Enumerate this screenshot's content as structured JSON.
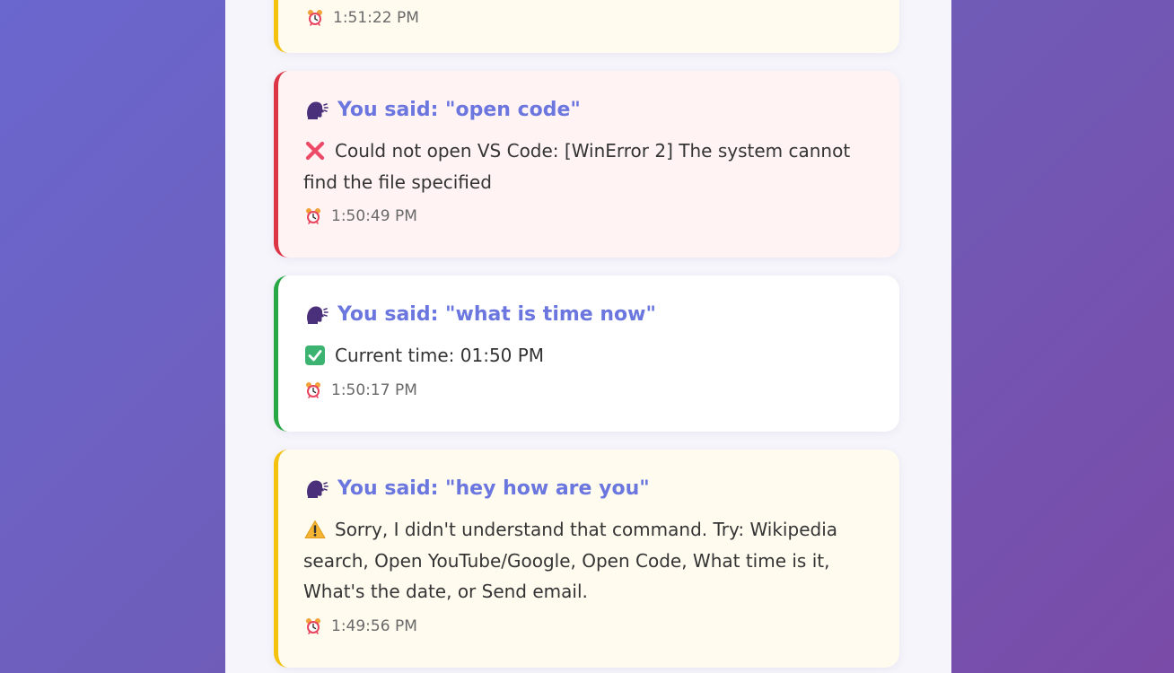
{
  "colors": {
    "background_gradient": [
      "#6a67ce",
      "#7a4ba8"
    ],
    "panel": "#f6f5fb",
    "said_text": "#6b77df",
    "warning_border": "#f4c20d",
    "error_border": "#dc3545",
    "success_border": "#28a745"
  },
  "entries": [
    {
      "status": "warning",
      "time": "1:51:22 PM"
    },
    {
      "status": "error",
      "said": "You said: \"open code\"",
      "response_icon": "cross-mark-icon",
      "response": "Could not open VS Code: [WinError 2] The system cannot find the file specified",
      "time": "1:50:49 PM"
    },
    {
      "status": "success",
      "said": "You said: \"what is time now\"",
      "response_icon": "check-mark-icon",
      "response": "Current time: 01:50 PM",
      "time": "1:50:17 PM"
    },
    {
      "status": "warning",
      "said": "You said: \"hey how are you\"",
      "response_icon": "warning-icon",
      "response": "Sorry, I didn't understand that command. Try: Wikipedia search, Open YouTube/Google, Open Code, What time is it, What's the date, or Send email.",
      "time": "1:49:56 PM"
    }
  ],
  "icons": {
    "said": "speaking-head-icon",
    "time": "alarm-clock-icon"
  }
}
